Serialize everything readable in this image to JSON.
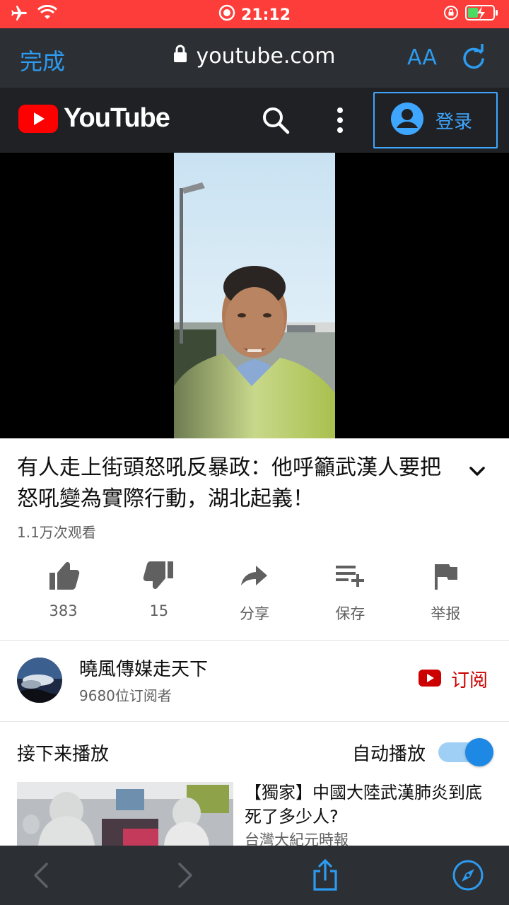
{
  "status_bar": {
    "time": "21:12",
    "icons": [
      "airplane-icon",
      "wifi-icon",
      "record-icon",
      "orientation-lock-icon",
      "battery-charging-icon"
    ]
  },
  "browser": {
    "done_label": "完成",
    "url": "youtube.com",
    "text_size_label": "AA",
    "accent_color": "#2d9bf0"
  },
  "youtube_header": {
    "logo_text": "YouTube",
    "login_label": "登录",
    "brand_color": "#ff0000"
  },
  "video": {
    "title": "有人走上街頭怒吼反暴政：他呼籲武漢人要把怒吼變為實際行動，湖北起義！",
    "views": "1.1万次观看"
  },
  "actions": [
    {
      "icon": "thumbs-up-icon",
      "label": "383"
    },
    {
      "icon": "thumbs-down-icon",
      "label": "15"
    },
    {
      "icon": "share-icon",
      "label": "分享"
    },
    {
      "icon": "add-to-playlist-icon",
      "label": "保存"
    },
    {
      "icon": "flag-icon",
      "label": "举报"
    }
  ],
  "channel": {
    "name": "曉風傳媒走天下",
    "subscribers": "9680位订阅者",
    "subscribe_label": "订阅"
  },
  "up_next": {
    "heading": "接下来播放",
    "autoplay_label": "自动播放",
    "autoplay_on": true,
    "items": [
      {
        "title": "【獨家】中國大陸武漢肺炎到底死了多少人?",
        "channel": "台灣大紀元時報"
      }
    ]
  }
}
